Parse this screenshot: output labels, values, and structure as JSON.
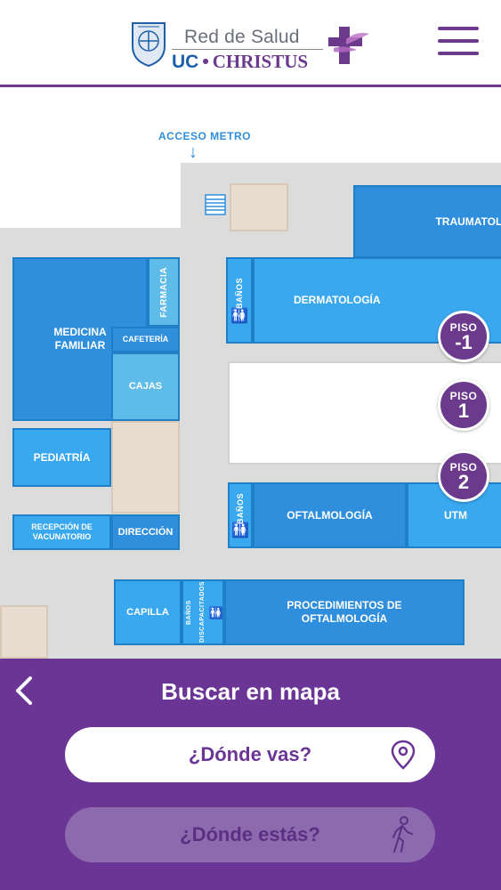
{
  "header": {
    "logo_top": "Red de Salud",
    "logo_uc": "UC",
    "logo_dot": "•",
    "logo_christus": "CHRISTUS",
    "menu_icon": "hamburger-menu-icon"
  },
  "map": {
    "metro_label": "ACCESO METRO",
    "rooms": {
      "traumatologia": "TRAUMATOLOGÍA",
      "medicina_familiar": "MEDICINA FAMILIAR",
      "farmacia": "FARMACIA",
      "cafeteria": "CAFETERÍA",
      "cajas": "CAJAS",
      "banos_1": "BAÑOS",
      "dermatologia": "DERMATOLOGÍA",
      "pediatria": "PEDIATRÍA",
      "recepcion": "RECEPCIÓN DE VACUNATORIO",
      "direccion": "DIRECCIÓN",
      "banos_2": "BAÑOS",
      "oftalmologia": "OFTALMOLOGÍA",
      "utm": "UTM",
      "capilla": "CAPILLA",
      "banos_discapacitados": "BAÑOS DISCAPACITADOS",
      "procedimientos": "PROCEDIMIENTOS DE OFTALMOLOGÍA"
    },
    "floors": [
      {
        "label": "PISO",
        "number": "-1"
      },
      {
        "label": "PISO",
        "number": "1"
      },
      {
        "label": "PISO",
        "number": "2"
      }
    ]
  },
  "panel": {
    "back_icon": "chevron-left-icon",
    "title": "Buscar en mapa",
    "destination_label": "¿Dónde vas?",
    "destination_icon": "map-pin-icon",
    "origin_label": "¿Dónde estás?",
    "origin_icon": "walking-person-icon"
  },
  "colors": {
    "brand_purple": "#6b3596",
    "room_blue": "#2f8fdc",
    "uc_blue": "#1d5fa8"
  }
}
